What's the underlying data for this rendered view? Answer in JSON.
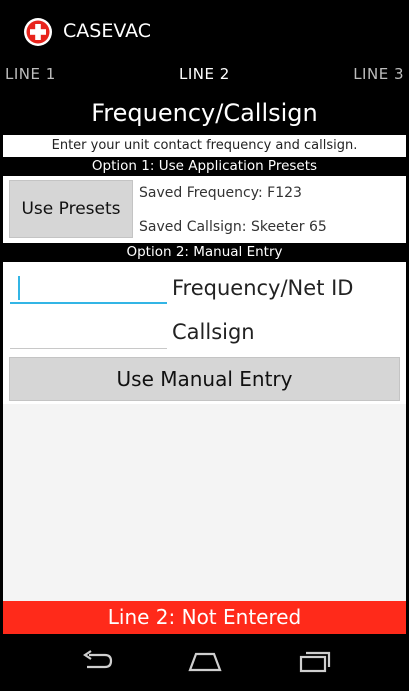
{
  "colors": {
    "bar_bg": "#000000",
    "status_red": "#ff2a1a",
    "focus_blue": "#33b5e5",
    "button_gray": "#d6d6d6"
  },
  "app": {
    "title": "CASEVAC",
    "icon": "red-cross-icon"
  },
  "tabs": [
    {
      "label": "LINE 1"
    },
    {
      "label": "LINE 2",
      "selected": true
    },
    {
      "label": "LINE 3"
    }
  ],
  "page": {
    "title": "Frequency/Callsign",
    "instructions": "Enter your unit contact frequency and callsign."
  },
  "option1": {
    "header": "Option 1: Use Application Presets",
    "button_label": "Use Presets",
    "saved_frequency": "Saved Frequency: F123",
    "saved_callsign": "Saved Callsign: Skeeter 65"
  },
  "option2": {
    "header": "Option 2: Manual Entry",
    "frequency_label": "Frequency/Net ID",
    "frequency_value": "",
    "callsign_label": "Callsign",
    "callsign_value": "",
    "button_label": "Use Manual Entry"
  },
  "status": {
    "text": "Line 2: Not Entered"
  },
  "navbar": {
    "icons": [
      "back-icon",
      "home-icon",
      "recents-icon"
    ]
  }
}
